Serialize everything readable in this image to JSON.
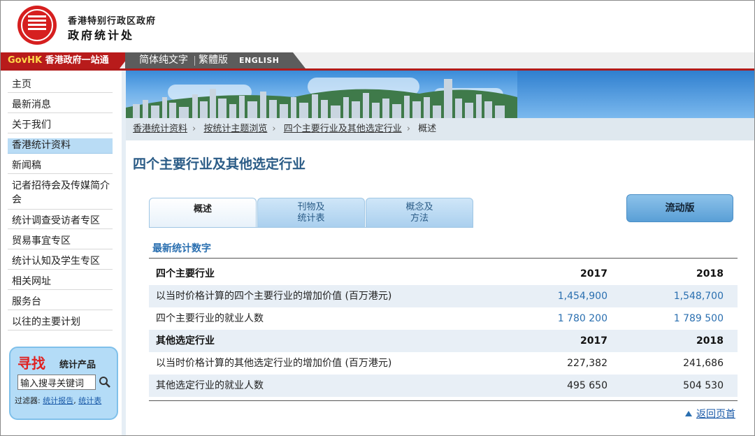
{
  "header": {
    "dept_line1": "香港特别行政区政府",
    "dept_line2": "政府统计处"
  },
  "navbar": {
    "govhk_prefix": "GovHK",
    "govhk_label": "香港政府一站通",
    "lang_simplified_text": "简体纯文字",
    "lang_traditional": "繁體版",
    "lang_english": "ENGLISH"
  },
  "sidebar": {
    "items": [
      {
        "label": "主页"
      },
      {
        "label": "最新消息"
      },
      {
        "label": "关于我们"
      },
      {
        "label": "香港统计资料"
      },
      {
        "label": "新闻稿"
      },
      {
        "label": "记者招待会及传媒简介会"
      },
      {
        "label": "统计调查受访者专区"
      },
      {
        "label": "贸易事宜专区"
      },
      {
        "label": "统计认知及学生专区"
      },
      {
        "label": "相关网址"
      },
      {
        "label": "服务台"
      },
      {
        "label": "以往的主要计划"
      }
    ],
    "active_index": 3,
    "search": {
      "title": "寻找",
      "subtitle": "统计产品",
      "input_value": "输入搜寻关键词",
      "filter_label": "过滤器:",
      "filter_option1": "统计报告",
      "filter_option2": "统计表"
    }
  },
  "breadcrumb": {
    "items": [
      "香港统计资料",
      "按统计主题浏览",
      "四个主要行业及其他选定行业",
      "概述"
    ]
  },
  "main": {
    "title": "四个主要行业及其他选定行业",
    "tabs": [
      {
        "label": "概述"
      },
      {
        "label_line1": "刊物及",
        "label_line2": "统计表"
      },
      {
        "label_line1": "概念及",
        "label_line2": "方法"
      }
    ],
    "mobile_button": "流动版",
    "section_heading": "最新统计数字",
    "table": {
      "group1_header": {
        "label": "四个主要行业",
        "y1": "2017",
        "y2": "2018"
      },
      "group1_rows": [
        {
          "label": "以当时价格计算的四个主要行业的增加价值 (百万港元)",
          "v2017": "1,454,900",
          "v2018": "1,548,700"
        },
        {
          "label": "四个主要行业的就业人数",
          "v2017": "1 780 200",
          "v2018": "1 789 500"
        }
      ],
      "group2_header": {
        "label": "其他选定行业",
        "y1": "2017",
        "y2": "2018"
      },
      "group2_rows": [
        {
          "label": "以当时价格计算的其他选定行业的增加价值 (百万港元)",
          "v2017": "227,382",
          "v2018": "241,686"
        },
        {
          "label": "其他选定行业的就业人数",
          "v2017": "495 650",
          "v2018": "504 530"
        }
      ]
    },
    "back_to_top": "返回页首"
  },
  "colors": {
    "govhk_red": "#b81b1b",
    "title_blue": "#2a5b86",
    "link_blue": "#2a6fb0",
    "active_nav": "#b9dcf5"
  }
}
